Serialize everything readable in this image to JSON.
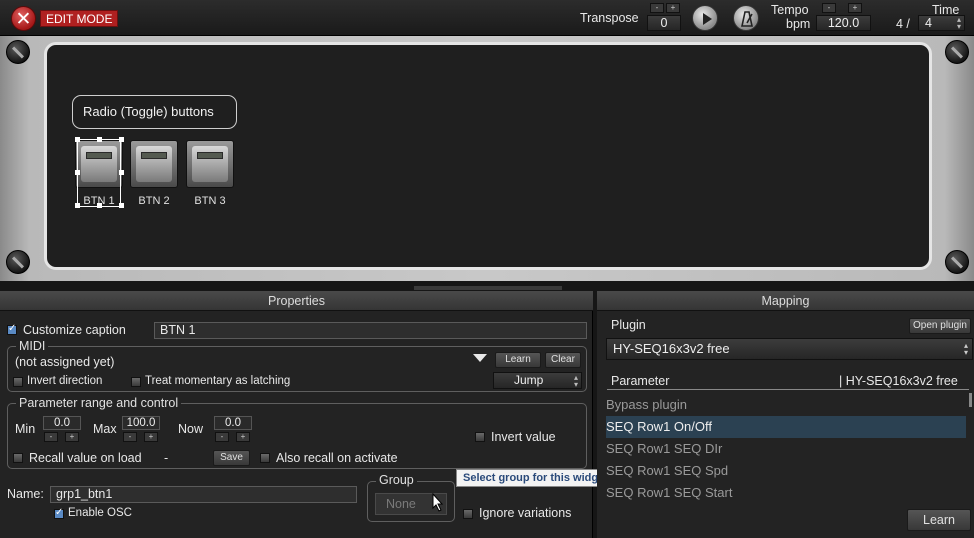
{
  "topbar": {
    "close_symbol": "✕",
    "edit_mode": "EDIT MODE",
    "transpose_label": "Transpose",
    "transpose_value": "0",
    "tempo_label": "Tempo",
    "tempo_unit": "bpm",
    "tempo_value": "120.0",
    "time_label": "Time",
    "time_numerator": "4 /",
    "time_denominator": "4",
    "minus": "-",
    "plus": "+"
  },
  "panel": {
    "group_caption": "Radio (Toggle) buttons",
    "buttons": [
      {
        "label": "BTN 1"
      },
      {
        "label": "BTN 2"
      },
      {
        "label": "BTN 3"
      }
    ]
  },
  "properties": {
    "title": "Properties",
    "customize_caption_label": "Customize caption",
    "customize_caption_value": "BTN 1",
    "midi": {
      "title": "MIDI",
      "status": "(not assigned yet)",
      "learn": "Learn",
      "clear": "Clear",
      "invert_direction": "Invert direction",
      "treat_momentary": "Treat momentary as latching",
      "mode": "Jump"
    },
    "range": {
      "title": "Parameter range and control",
      "min_label": "Min",
      "min_value": "0.0",
      "max_label": "Max",
      "max_value": "100.0",
      "now_label": "Now",
      "now_value": "0.0",
      "invert_value": "Invert value",
      "recall_value": "Recall value on load",
      "recall_dash": "-",
      "save": "Save",
      "also_recall": "Also recall on activate"
    },
    "name_label": "Name:",
    "name_value": "grp1_btn1",
    "enable_osc": "Enable OSC",
    "group_title": "Group",
    "group_value": "None",
    "ignore_variations": "Ignore variations",
    "tooltip": "Select group for this widget"
  },
  "mapping": {
    "title": "Mapping",
    "plugin_label": "Plugin",
    "open_plugin": "Open plugin",
    "plugin_value": "HY-SEQ16x3v2 free",
    "parameter_header": "Parameter",
    "parameter_plugin": "| HY-SEQ16x3v2 free",
    "params": [
      {
        "label": "Bypass plugin"
      },
      {
        "label": "SEQ Row1 On/Off"
      },
      {
        "label": "SEQ Row1 SEQ DIr"
      },
      {
        "label": "SEQ Row1 SEQ Spd"
      },
      {
        "label": "SEQ Row1 SEQ Start"
      }
    ],
    "selected_index": 1,
    "learn": "Learn"
  }
}
